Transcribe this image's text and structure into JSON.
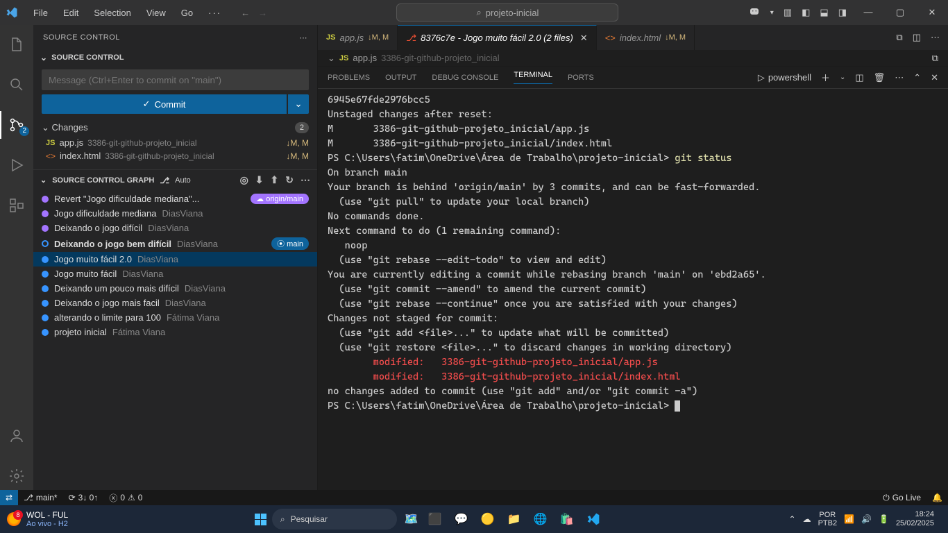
{
  "menu": {
    "file": "File",
    "edit": "Edit",
    "selection": "Selection",
    "view": "View",
    "go": "Go",
    "more": "···"
  },
  "titlebar": {
    "search": "projeto-inicial"
  },
  "sourceControl": {
    "title": "SOURCE CONTROL",
    "section": "SOURCE CONTROL",
    "commitPlaceholder": "Message (Ctrl+Enter to commit on \"main\")",
    "commit": "Commit",
    "changesLabel": "Changes",
    "changesCount": "2",
    "files": [
      {
        "icon": "JS",
        "name": "app.js",
        "path": "3386-git-github-projeto_inicial",
        "status": "↓M, M"
      },
      {
        "icon": "<>",
        "name": "index.html",
        "path": "3386-git-github-projeto_inicial",
        "status": "↓M, M"
      }
    ]
  },
  "graph": {
    "title": "SOURCE CONTROL GRAPH",
    "auto": "Auto",
    "originBadge": "origin/main",
    "mainBadge": "main",
    "commits": [
      {
        "dot": "purple",
        "msg": "Revert \"Jogo dificuldade mediana\"...",
        "author": "",
        "pill": "origin"
      },
      {
        "dot": "purple",
        "msg": "Jogo dificuldade mediana",
        "author": "DiasViana"
      },
      {
        "dot": "purple",
        "msg": "Deixando o jogo difícil",
        "author": "DiasViana"
      },
      {
        "dot": "ring",
        "msg": "Deixando o jogo bem difícil",
        "author": "DiasViana",
        "bold": true,
        "pill": "main"
      },
      {
        "dot": "blue",
        "msg": "Jogo muito fácil 2.0",
        "author": "DiasViana",
        "selected": true
      },
      {
        "dot": "blue",
        "msg": "Jogo muito fácil",
        "author": "DiasViana"
      },
      {
        "dot": "blue",
        "msg": "Deixando um pouco mais difícil",
        "author": "DiasViana"
      },
      {
        "dot": "blue",
        "msg": "Deixando o jogo mais facil",
        "author": "DiasViana"
      },
      {
        "dot": "blue",
        "msg": "alterando o limite para 100",
        "author": "Fátima Viana"
      },
      {
        "dot": "blue",
        "msg": "projeto inicial",
        "author": "Fátima Viana"
      }
    ]
  },
  "tabs": [
    {
      "icon": "JS",
      "label": "app.js",
      "mod": "↓M, M"
    },
    {
      "icon": "git",
      "label": "8376c7e - Jogo muito fácil 2.0 (2 files)",
      "active": true,
      "close": true
    },
    {
      "icon": "<>",
      "label": "index.html",
      "mod": "↓M, M"
    }
  ],
  "breadcrumb": {
    "icon": "JS",
    "file": "app.js",
    "path": "3386-git-github-projeto_inicial"
  },
  "panelTabs": {
    "problems": "PROBLEMS",
    "output": "OUTPUT",
    "debug": "DEBUG CONSOLE",
    "terminal": "TERMINAL",
    "ports": "PORTS",
    "shell": "powershell"
  },
  "terminal": {
    "lines": [
      {
        "t": "6945e67fde2976bcc5"
      },
      {
        "t": "Unstaged changes after reset:"
      },
      {
        "t": "M       3386-git-github-projeto_inicial/app.js"
      },
      {
        "t": "M       3386-git-github-projeto_inicial/index.html"
      },
      {
        "prompt": "PS C:\\Users\\fatim\\OneDrive\\Área de Trabalho\\projeto-inicial> ",
        "cmd": "git status"
      },
      {
        "t": "On branch main"
      },
      {
        "t": "Your branch is behind 'origin/main' by 3 commits, and can be fast-forwarded."
      },
      {
        "t": "  (use \"git pull\" to update your local branch)"
      },
      {
        "t": ""
      },
      {
        "t": "No commands done."
      },
      {
        "t": "Next command to do (1 remaining command):"
      },
      {
        "t": "   noop"
      },
      {
        "t": "  (use \"git rebase --edit-todo\" to view and edit)"
      },
      {
        "t": "You are currently editing a commit while rebasing branch 'main' on 'ebd2a65'."
      },
      {
        "t": "  (use \"git commit --amend\" to amend the current commit)"
      },
      {
        "t": "  (use \"git rebase --continue\" once you are satisfied with your changes)"
      },
      {
        "t": ""
      },
      {
        "t": "Changes not staged for commit:"
      },
      {
        "t": "  (use \"git add <file>...\" to update what will be committed)"
      },
      {
        "t": "  (use \"git restore <file>...\" to discard changes in working directory)"
      },
      {
        "cls": "r",
        "t": "        modified:   3386-git-github-projeto_inicial/app.js"
      },
      {
        "cls": "r",
        "t": "        modified:   3386-git-github-projeto_inicial/index.html"
      },
      {
        "t": ""
      },
      {
        "t": "no changes added to commit (use \"git add\" and/or \"git commit -a\")"
      },
      {
        "prompt": "PS C:\\Users\\fatim\\OneDrive\\Área de Trabalho\\projeto-inicial> ",
        "cursor": true
      }
    ]
  },
  "statusbar": {
    "branch": "main*",
    "sync": "3↓ 0↑",
    "errors": "0",
    "warnings": "0",
    "golive": "Go Live"
  },
  "taskbar": {
    "weather1": "WOL - FUL",
    "weather2": "Ao vivo - H2",
    "weatherBadge": "8",
    "search": "Pesquisar",
    "lang1": "POR",
    "lang2": "PTB2",
    "time": "18:24",
    "date": "25/02/2025"
  },
  "activitybar": {
    "scmBadge": "2"
  }
}
